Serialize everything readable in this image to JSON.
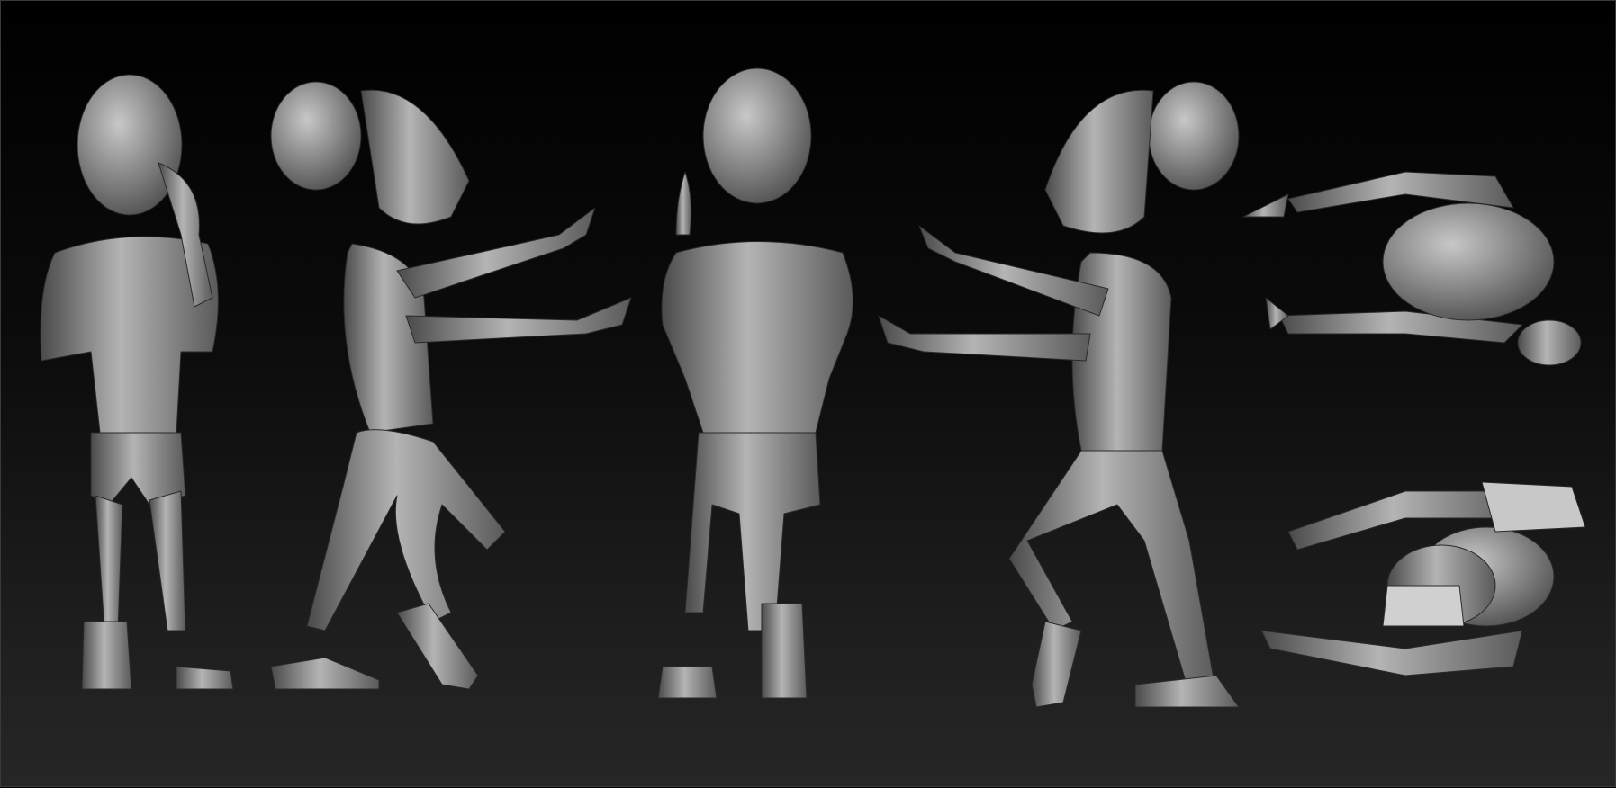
{
  "scene": {
    "background_top": "#000000",
    "background_bottom": "#262626",
    "model_color": "#8c8c8c",
    "model_highlight": "#c8c8c8",
    "model_shadow": "#3c3c3c",
    "views": [
      "front",
      "side-left",
      "back",
      "side-right",
      "top",
      "bottom"
    ]
  }
}
